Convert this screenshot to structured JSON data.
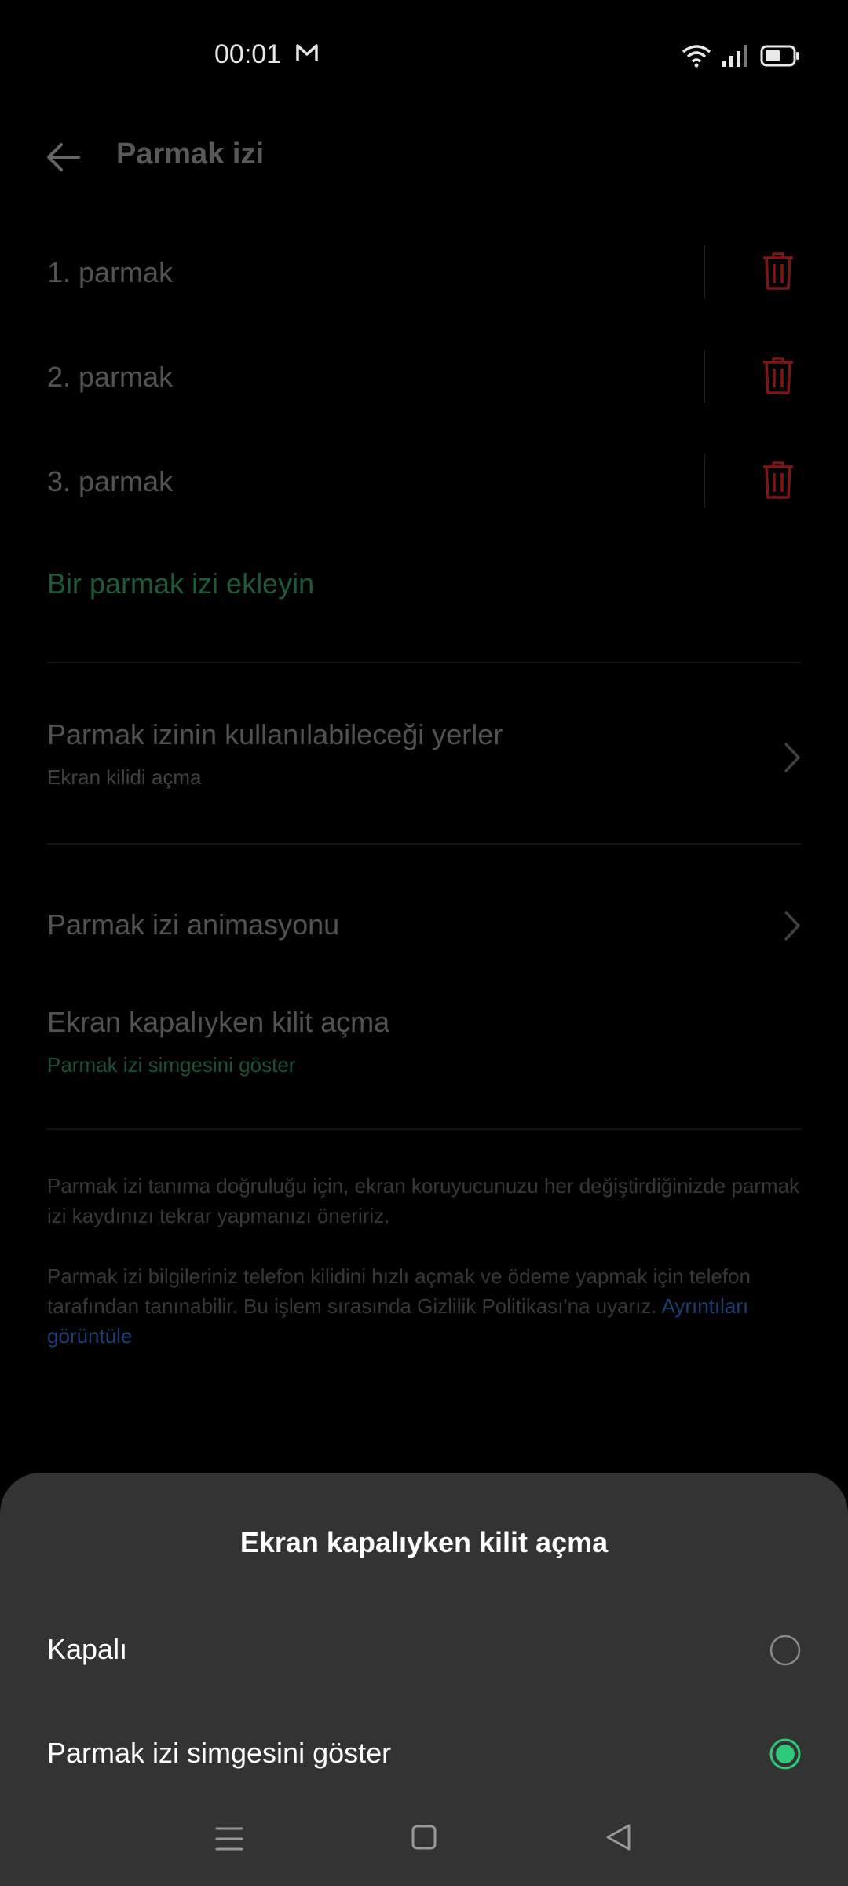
{
  "status_bar": {
    "time": "00:01"
  },
  "header": {
    "title": "Parmak izi"
  },
  "fingerprints": [
    {
      "label": "1. parmak"
    },
    {
      "label": "2. parmak"
    },
    {
      "label": "3. parmak"
    }
  ],
  "add_fingerprint": "Bir parmak izi ekleyin",
  "settings": {
    "usage_title": "Parmak izinin kullanılabileceği yerler",
    "usage_sub": "Ekran kilidi açma",
    "animation_title": "Parmak izi animasyonu",
    "screen_off_title": "Ekran kapalıyken kilit açma",
    "screen_off_sub": "Parmak izi simgesini göster"
  },
  "notes": {
    "note1": "Parmak izi tanıma doğruluğu için, ekran koruyucunuzu her değiştirdiğinizde parmak izi kaydınızı tekrar yapmanızı öneririz.",
    "note2": "Parmak izi bilgileriniz telefon kilidini hızlı açmak ve ödeme yapmak için telefon tarafından tanınabilir. Bu işlem sırasında Gizlilik Politikası'na uyarız.",
    "link": "Ayrıntıları görüntüle"
  },
  "sheet": {
    "title": "Ekran kapalıyken kilit açma",
    "options": [
      {
        "label": "Kapalı",
        "selected": false
      },
      {
        "label": "Parmak izi simgesini göster",
        "selected": true
      }
    ]
  },
  "colors": {
    "accent": "#2fc97a",
    "delete_red": "#7a1717",
    "sheet_bg": "#333333"
  }
}
